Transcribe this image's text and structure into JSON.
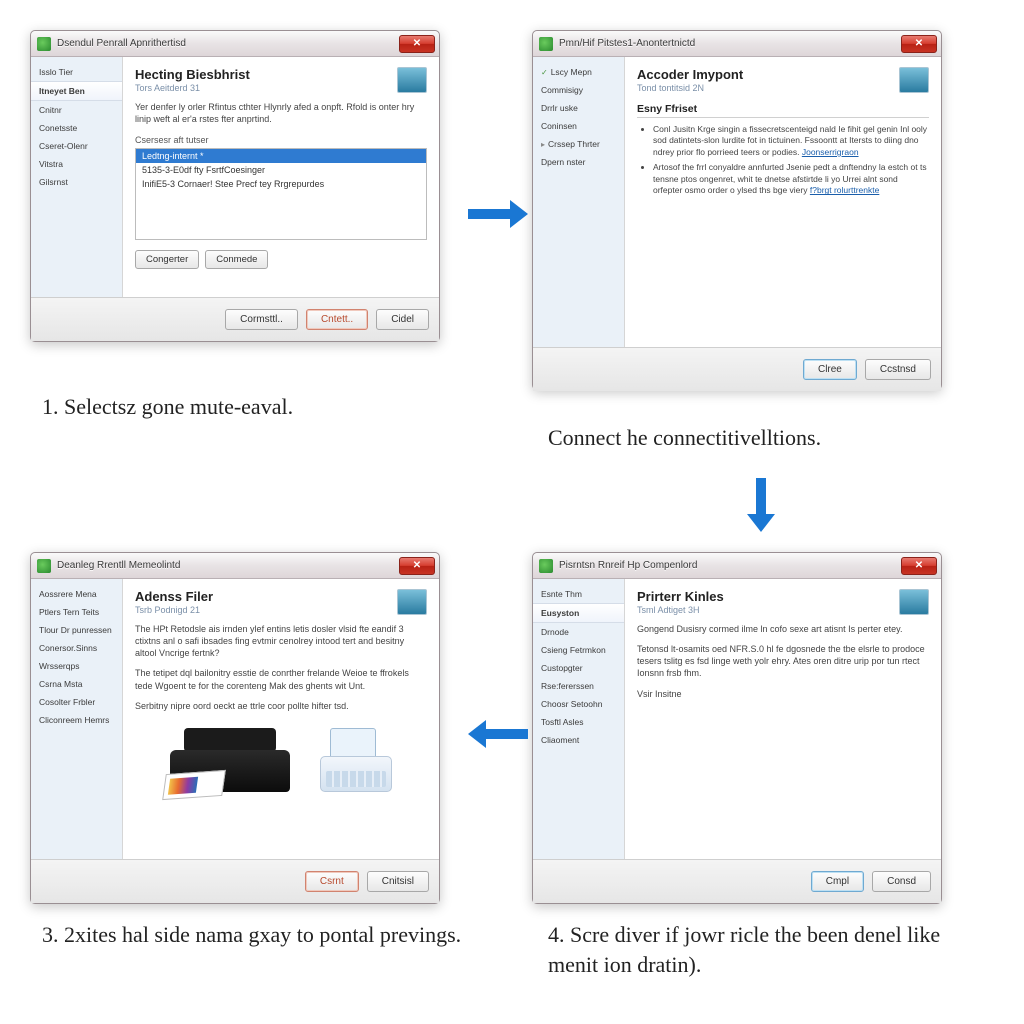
{
  "captions": {
    "c1": "1.  Selectsz gone mute-eaval.",
    "c2": "Connect he connectitivelltions.",
    "c3": "3.  2xites hal side nama gxay to pontal prevings.",
    "c4": "4.  Scre diver if jowr ricle the been denel like menit ion dratin)."
  },
  "d1": {
    "title": "Dsendul Penrall Apnrithertisd",
    "sidebar": [
      "Isslo Tier",
      "Itneyet Ben",
      "Cnitnr",
      "Conetsste",
      "Cseret-Olenr",
      "Vitstra",
      "Gilsrnst"
    ],
    "selIndex": 1,
    "heading": "Hecting Biesbhrist",
    "sub": "Tors Aeitderd 31",
    "desc": "Yer denfer ly orler Rfintus cthter Hlynrly afed a onpft. Rfold is onter hry linip weft al er'a rstes fter anprtind.",
    "listLabel": "Csersesr aft tutser",
    "rows": [
      "Ledtng-internt  *",
      "5135-3-E0df fty FsrtfCoesinger",
      "InifiE5-3 Cornaer! Stee Precf tey Rrgrepurdes"
    ],
    "btnA": "Congerter",
    "btnB": "Conmede",
    "footer": [
      "Cormsttl..",
      "Cntett..",
      "Cidel"
    ]
  },
  "d2": {
    "title": "Pmn/Hif Pitstes1-Anontertnictd",
    "sidebar": [
      "Lscy Mepn",
      "Commisigy",
      "Drrlr uske",
      "Coninsen",
      "Crssep Thrter",
      "Dpern nster"
    ],
    "heading": "Accoder Imypont",
    "sub": "Tond tontitsid 2N",
    "section": "Esny Ffriset",
    "b1": "Conl Jusitn Krge singin a fissecretscenteigd nald Ie fihit gel genin Inl ooly sod datintets-slon lurdite fot in tictuinen. Fssoontt at Itersts to diing dno ndrey prior flo porrieed teers or podies.",
    "b1link": "Joonserrigraon",
    "b2": "Artosof the frrl conyaldre annfurted Jsenie pedt a dnftendny la estch ot ts tensne ptos ongenret, whit te dnetse afstirtde li yo Urrei alnt sond orfepter osmo order o ylsed ths bge viery",
    "b2link": "f?brgt rolurttrenkte",
    "footer": [
      "Clree",
      "Ccstnsd"
    ]
  },
  "d3": {
    "title": "Deanleg Rrentll Memeolintd",
    "sidebar": [
      "Aossrere Mena",
      "Ptlers Tern Teits",
      "Tlour Dr punressen",
      "Conersor.Sinns",
      "Wrsserqps",
      "Csrna Msta",
      "Cosolter Frbler",
      "Cliconreem Hemrs"
    ],
    "heading": "Adenss Filer",
    "sub": "Tsrb Podnigd 21",
    "p1": "The HPt Retodsle ais irnden ylef entins letis dosler  vlsid fte eandif 3 ctixtns anl o safi ibsades fing evtmir cenolrey intood tert and besitny altool Vncrige fertnk?",
    "p2": "The tetipet dql bailonitry esstie de conrther frelande Weioe te ffrokels tede Wgoent te for the corenteng Mak des ghents wit Unt.",
    "p3": "Serbitny nipre oord oeckt ae ttrle coor pollte hifter tsd.",
    "footer": [
      "Csrnt",
      "Cnitsisl"
    ]
  },
  "d4": {
    "title": "Pisrntsn Rnreif Hp Compenlord",
    "sidebar": [
      "Esnte Thm",
      "Eusyston",
      "Drnode",
      "Csieng Fetrmkon",
      "Custopgter",
      "Rse:fererssen",
      "Choosr Setoohn",
      "Tosftl Asles",
      "Cliaoment"
    ],
    "selIndex": 1,
    "heading": "Prirterr Kinles",
    "sub": "Tsml Adtiget 3H",
    "p1": "Gongend Dusisry cormed ilme ln cofo sexe art atisnt Is perter etey.",
    "p2": "Tetonsd lt-osamits oed NFR.S.0 hl fe dgosnede the tbe elsrle to prodoce tesers tslitg es fsd linge weth yolr ehry. Ates oren ditre urip por tun rtect Ionsnn frsb fhm.",
    "p3": "Vsir Insitne",
    "footer": [
      "Cmpl",
      "Consd"
    ]
  }
}
